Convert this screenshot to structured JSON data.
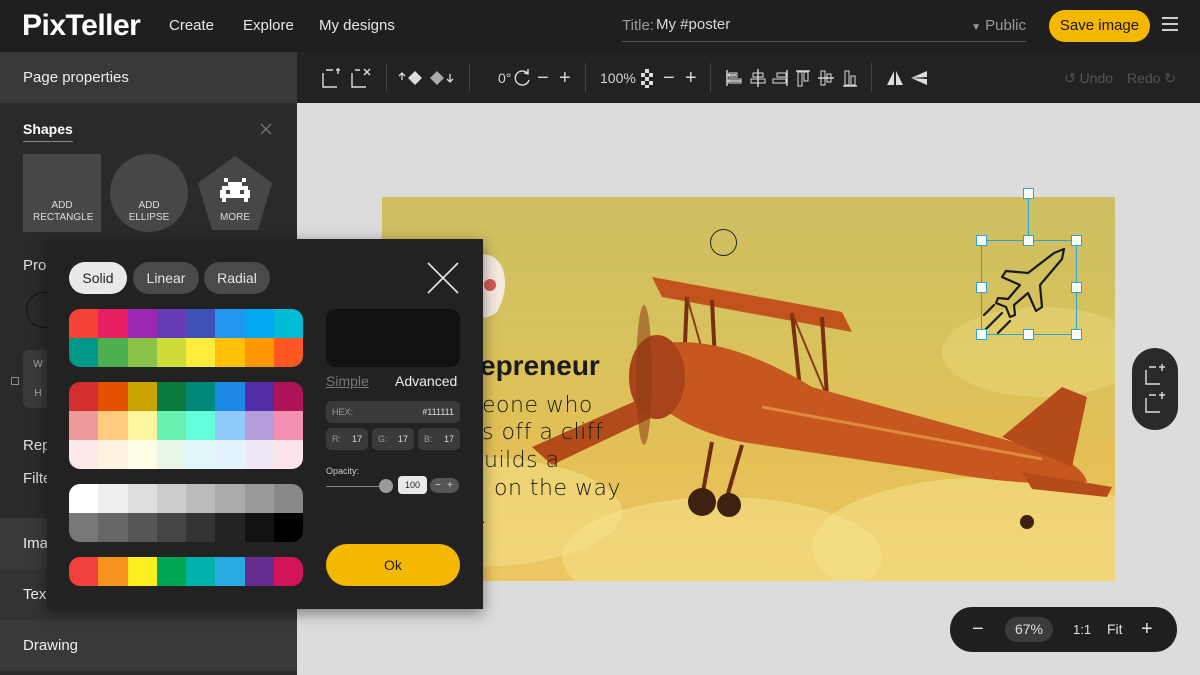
{
  "app": {
    "logo": "PixTeller",
    "nav": [
      "Create",
      "Explore",
      "My designs"
    ],
    "title_label": "Title:",
    "title_value": "My #poster",
    "visibility": "Public",
    "save_label": "Save image"
  },
  "sidebar": {
    "page_properties": "Page properties",
    "shapes_title": "Shapes",
    "shapes": [
      {
        "label": "ADD RECTANGLE"
      },
      {
        "label": "ADD ELLIPSE"
      },
      {
        "label": "MORE"
      }
    ],
    "partial_labels": [
      "Prop",
      "Rep",
      "Filte",
      "W",
      "H"
    ],
    "sections": [
      "Ima",
      "Tex",
      "Drawing"
    ]
  },
  "toolbar": {
    "rotation": "0°",
    "opacity": "100%",
    "undo": "Undo",
    "redo": "Redo"
  },
  "poster": {
    "headline": "epreneur",
    "body_lines": [
      "eone who",
      "s off a cliff",
      "uilds a",
      "on the way",
      "."
    ]
  },
  "zoom": {
    "value": "67%",
    "one_to_one": "1:1",
    "fit": "Fit"
  },
  "picker": {
    "tabs": [
      "Solid",
      "Linear",
      "Radial"
    ],
    "active_tab": "Solid",
    "modes": {
      "simple": "Simple",
      "advanced": "Advanced"
    },
    "hex_label": "HEX:",
    "hex_value": "#111111",
    "r_label": "R:",
    "r_value": "17",
    "g_label": "G:",
    "g_value": "17",
    "b_label": "B:",
    "b_value": "17",
    "opacity_label": "Opacity:",
    "opacity_value": "100",
    "ok_label": "Ok",
    "palette_primary": [
      "#f44336",
      "#e91e63",
      "#9c27b0",
      "#673ab7",
      "#3f51b5",
      "#2196f3",
      "#03a9f4",
      "#00bcd4",
      "#009688",
      "#4caf50",
      "#8bc34a",
      "#cddc39",
      "#ffeb3b",
      "#ffc107",
      "#ff9800",
      "#ff5722"
    ],
    "palette_tones": [
      "#d32f2f",
      "#e65100",
      "#c9a400",
      "#0a7a3c",
      "#00897b",
      "#1e88e5",
      "#512da8",
      "#ad1457",
      "#ef9a9a",
      "#ffcc80",
      "#fff59d",
      "#69f0ae",
      "#64ffda",
      "#90caf9",
      "#b39ddb",
      "#f48fb1",
      "#fbe9e7",
      "#fff3e0",
      "#fffde7",
      "#e8f5e9",
      "#e0f7fa",
      "#e3f2fd",
      "#ede7f6",
      "#fce4ec"
    ],
    "palette_grays": [
      "#ffffff",
      "#eeeeee",
      "#dddddd",
      "#cccccc",
      "#bbbbbb",
      "#aaaaaa",
      "#999999",
      "#888888",
      "#777777",
      "#666666",
      "#555555",
      "#444444",
      "#333333",
      "#222222",
      "#111111",
      "#000000"
    ],
    "palette_vivid": [
      "#f0413f",
      "#f7931e",
      "#fcee21",
      "#00a651",
      "#00b2a9",
      "#29abe2",
      "#662d91",
      "#d4145a"
    ],
    "preview_color": "#111111"
  }
}
